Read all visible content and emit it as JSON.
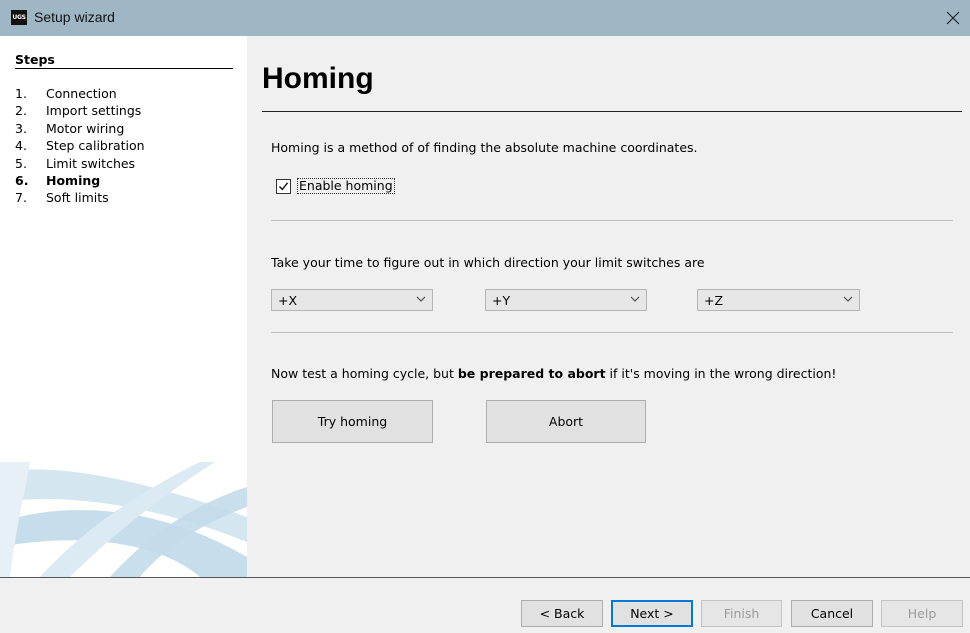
{
  "window": {
    "title": "Setup wizard",
    "app_icon_text": "UGS"
  },
  "sidebar": {
    "title": "Steps",
    "steps": [
      {
        "num": "1.",
        "label": "Connection"
      },
      {
        "num": "2.",
        "label": "Import settings"
      },
      {
        "num": "3.",
        "label": "Motor wiring"
      },
      {
        "num": "4.",
        "label": "Step calibration"
      },
      {
        "num": "5.",
        "label": "Limit switches"
      },
      {
        "num": "6.",
        "label": "Homing",
        "active": true
      },
      {
        "num": "7.",
        "label": "Soft limits"
      }
    ]
  },
  "main": {
    "title": "Homing",
    "description": "Homing is a method of of finding the absolute machine coordinates.",
    "enable_homing": {
      "label": "Enable homing",
      "checked": true
    },
    "direction_text": "Take your time to figure out in which direction your limit switches are",
    "directions": {
      "x": "+X",
      "y": "+Y",
      "z": "+Z"
    },
    "abort_text": {
      "before": "Now test a homing cycle, but ",
      "bold": "be prepared to abort",
      "after": " if it's moving in the wrong direction!"
    },
    "try_homing_label": "Try homing",
    "abort_label": "Abort"
  },
  "footer": {
    "back_label": "< Back",
    "next_label": "Next >",
    "finish_label": "Finish",
    "cancel_label": "Cancel",
    "help_label": "Help"
  }
}
